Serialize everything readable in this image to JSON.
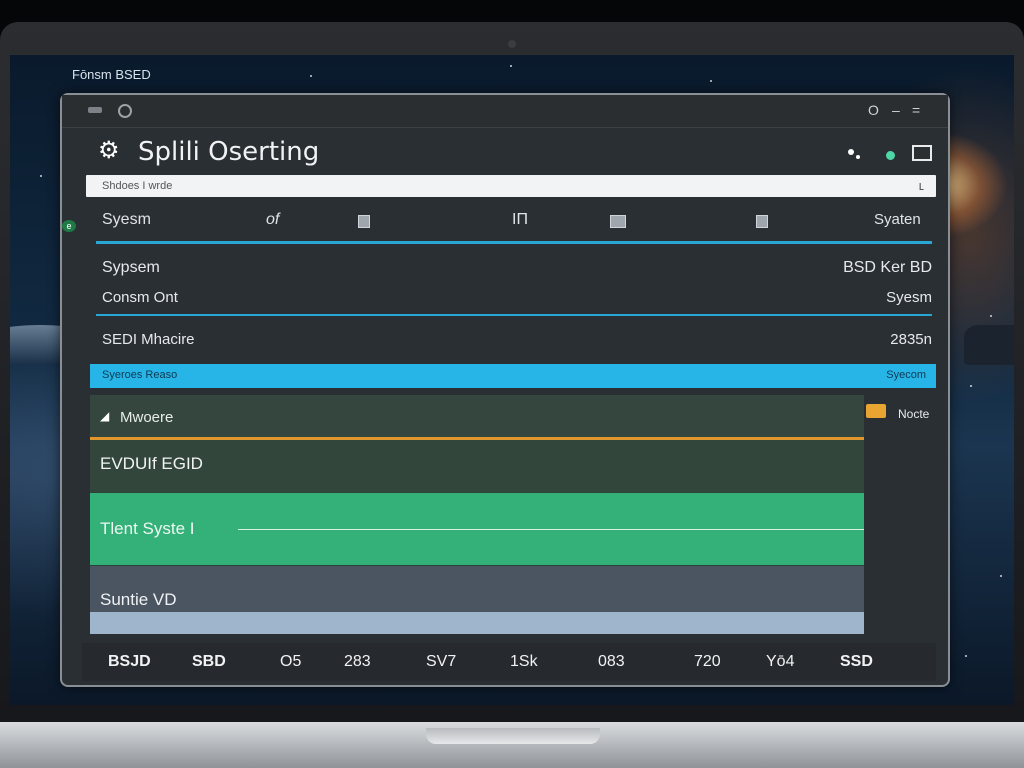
{
  "desktop": {
    "label": "Fōnsm BSED"
  },
  "window": {
    "controls": {
      "o": "O",
      "min": "–",
      "max": "="
    },
    "title": "Splili Oserting"
  },
  "search": {
    "placeholder": "Shdoes I wrde"
  },
  "columns": {
    "col1": "Syesm",
    "col2": "of",
    "col3": "IП",
    "col4": "Syaten"
  },
  "side_badge": "e",
  "info": [
    {
      "left": "Sypsem",
      "right": "BSD Ker BD"
    },
    {
      "left": "Consm Ont",
      "right": "Syesm"
    },
    {
      "left": "SEDI Mhacire",
      "right": "2835n"
    }
  ],
  "highlight": {
    "left": "Syeroes Reaso",
    "right": "Syecom"
  },
  "panel": {
    "title": "Mwoere",
    "rows": [
      "EVDUIf EGID",
      "Tlent Syste I",
      "Suntie VD"
    ]
  },
  "note": {
    "label": "Nocte"
  },
  "footer": [
    "BSJD",
    "SBD",
    "O5",
    "283",
    "SV7",
    "1Sk",
    "083",
    "720",
    "Yō4",
    "SSD"
  ],
  "colors": {
    "accent_blue": "#27b5e8",
    "accent_green": "#34b179",
    "accent_orange": "#e2962e",
    "status_dot": "#4fd6a6"
  }
}
